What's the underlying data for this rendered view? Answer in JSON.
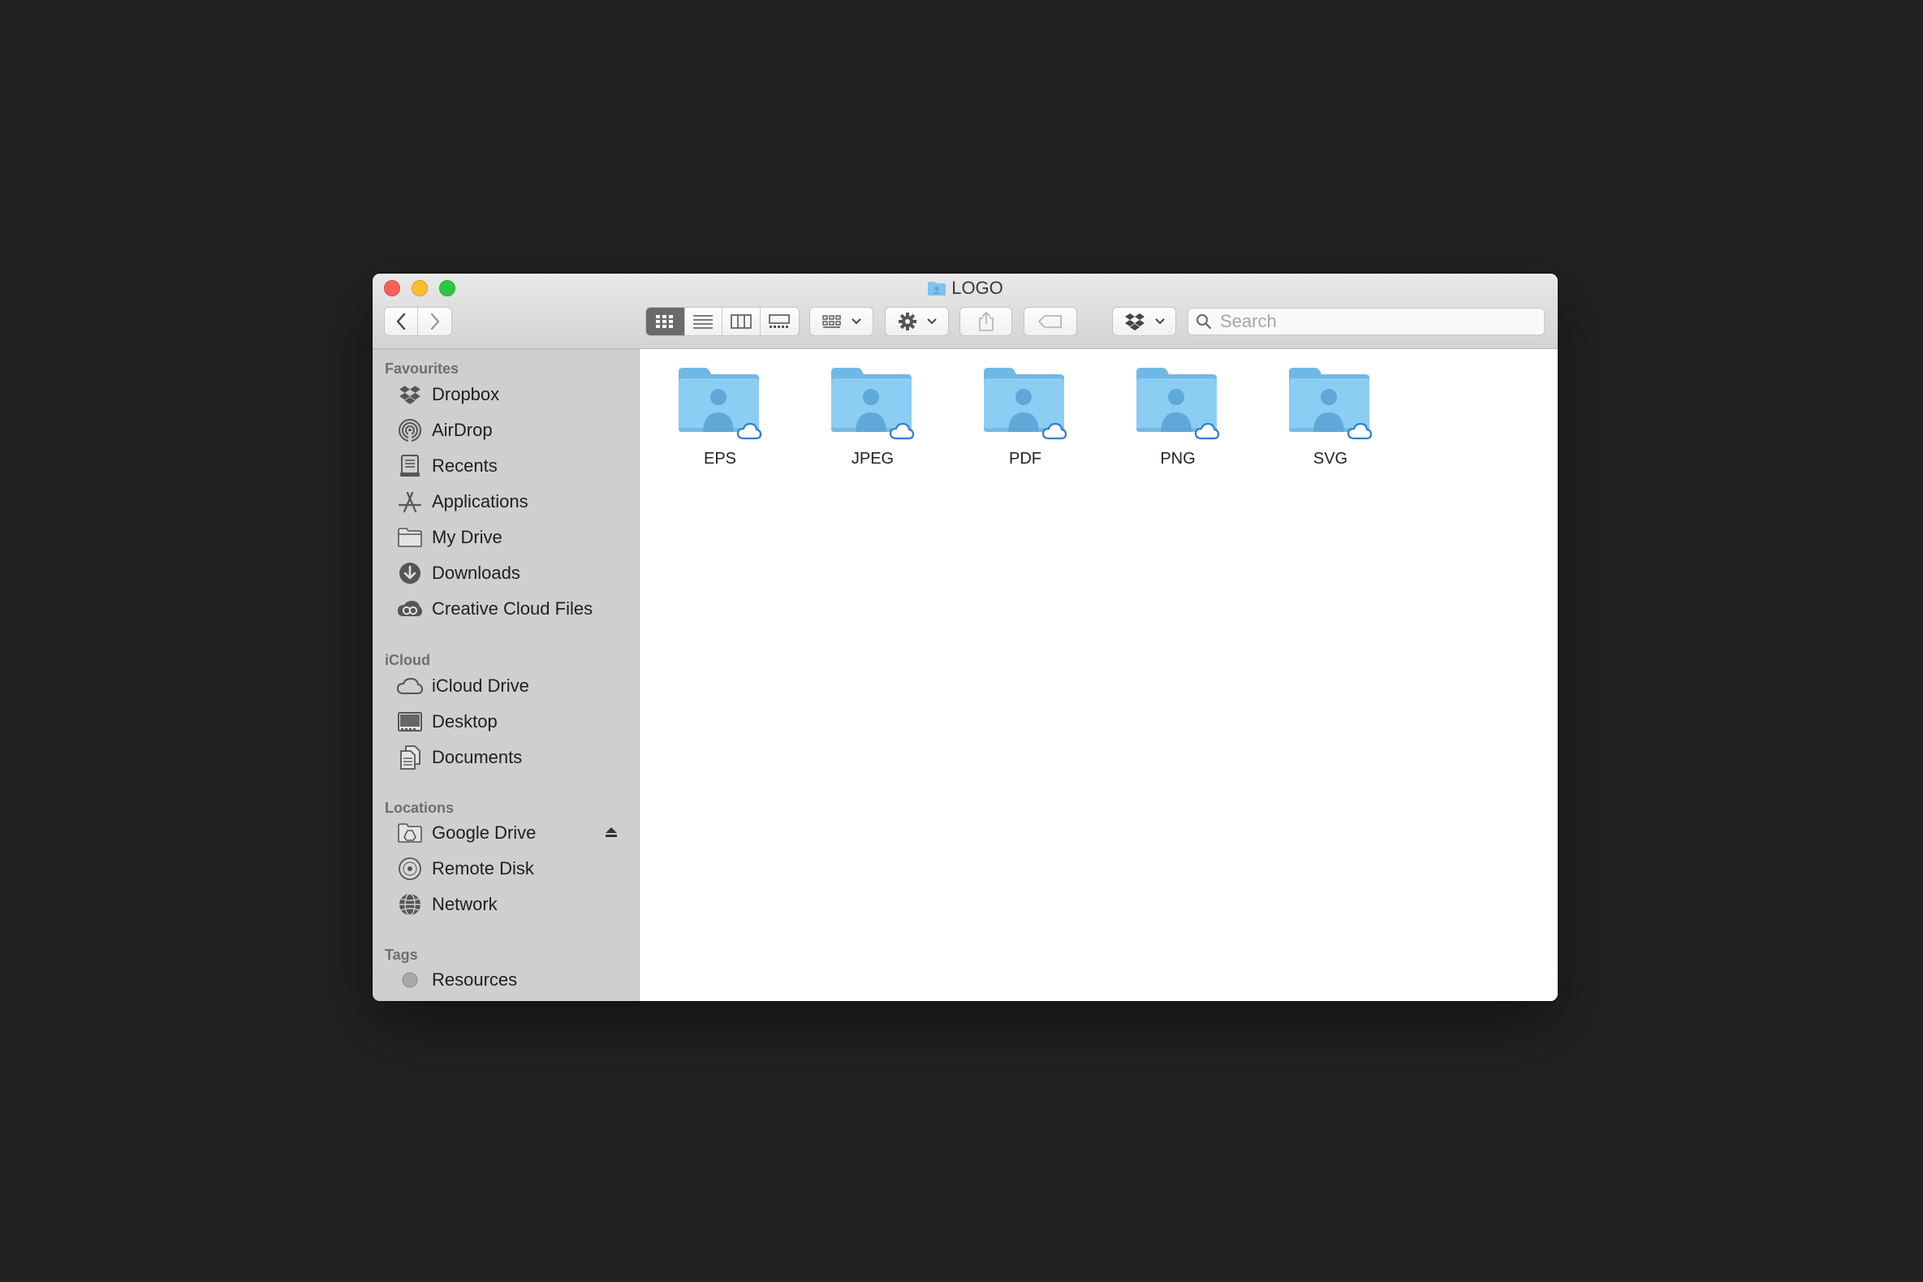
{
  "window": {
    "title": "LOGO"
  },
  "toolbar": {
    "search_placeholder": "Search",
    "view_modes": [
      "icon-view",
      "list-view",
      "column-view",
      "gallery-view"
    ],
    "active_view": "icon-view"
  },
  "sidebar": {
    "sections": [
      {
        "title": "Favourites",
        "items": [
          {
            "label": "Dropbox",
            "icon": "dropbox-icon"
          },
          {
            "label": "AirDrop",
            "icon": "airdrop-icon"
          },
          {
            "label": "Recents",
            "icon": "recents-icon"
          },
          {
            "label": "Applications",
            "icon": "applications-icon"
          },
          {
            "label": "My Drive",
            "icon": "folder-icon"
          },
          {
            "label": "Downloads",
            "icon": "downloads-icon"
          },
          {
            "label": "Creative Cloud Files",
            "icon": "creative-cloud-icon"
          }
        ]
      },
      {
        "title": "iCloud",
        "items": [
          {
            "label": "iCloud Drive",
            "icon": "icloud-icon"
          },
          {
            "label": "Desktop",
            "icon": "desktop-icon"
          },
          {
            "label": "Documents",
            "icon": "documents-icon"
          }
        ]
      },
      {
        "title": "Locations",
        "items": [
          {
            "label": "Google Drive",
            "icon": "google-drive-icon"
          },
          {
            "label": "Remote Disk",
            "icon": "remote-disk-icon"
          },
          {
            "label": "Network",
            "icon": "network-icon"
          }
        ]
      },
      {
        "title": "Tags",
        "items": [
          {
            "label": "Resources",
            "icon": "tag-dot-icon"
          }
        ]
      }
    ]
  },
  "content": {
    "folders": [
      {
        "name": "EPS"
      },
      {
        "name": "JPEG"
      },
      {
        "name": "PDF"
      },
      {
        "name": "PNG"
      },
      {
        "name": "SVG"
      }
    ]
  },
  "colors": {
    "desktop_bg": "#222222",
    "sidebar_bg": "#cfcfcf",
    "folder_blue": "#7cc3ee",
    "close": "#fc5f57",
    "minimize": "#fdbc2e",
    "maximize": "#2ac840"
  }
}
